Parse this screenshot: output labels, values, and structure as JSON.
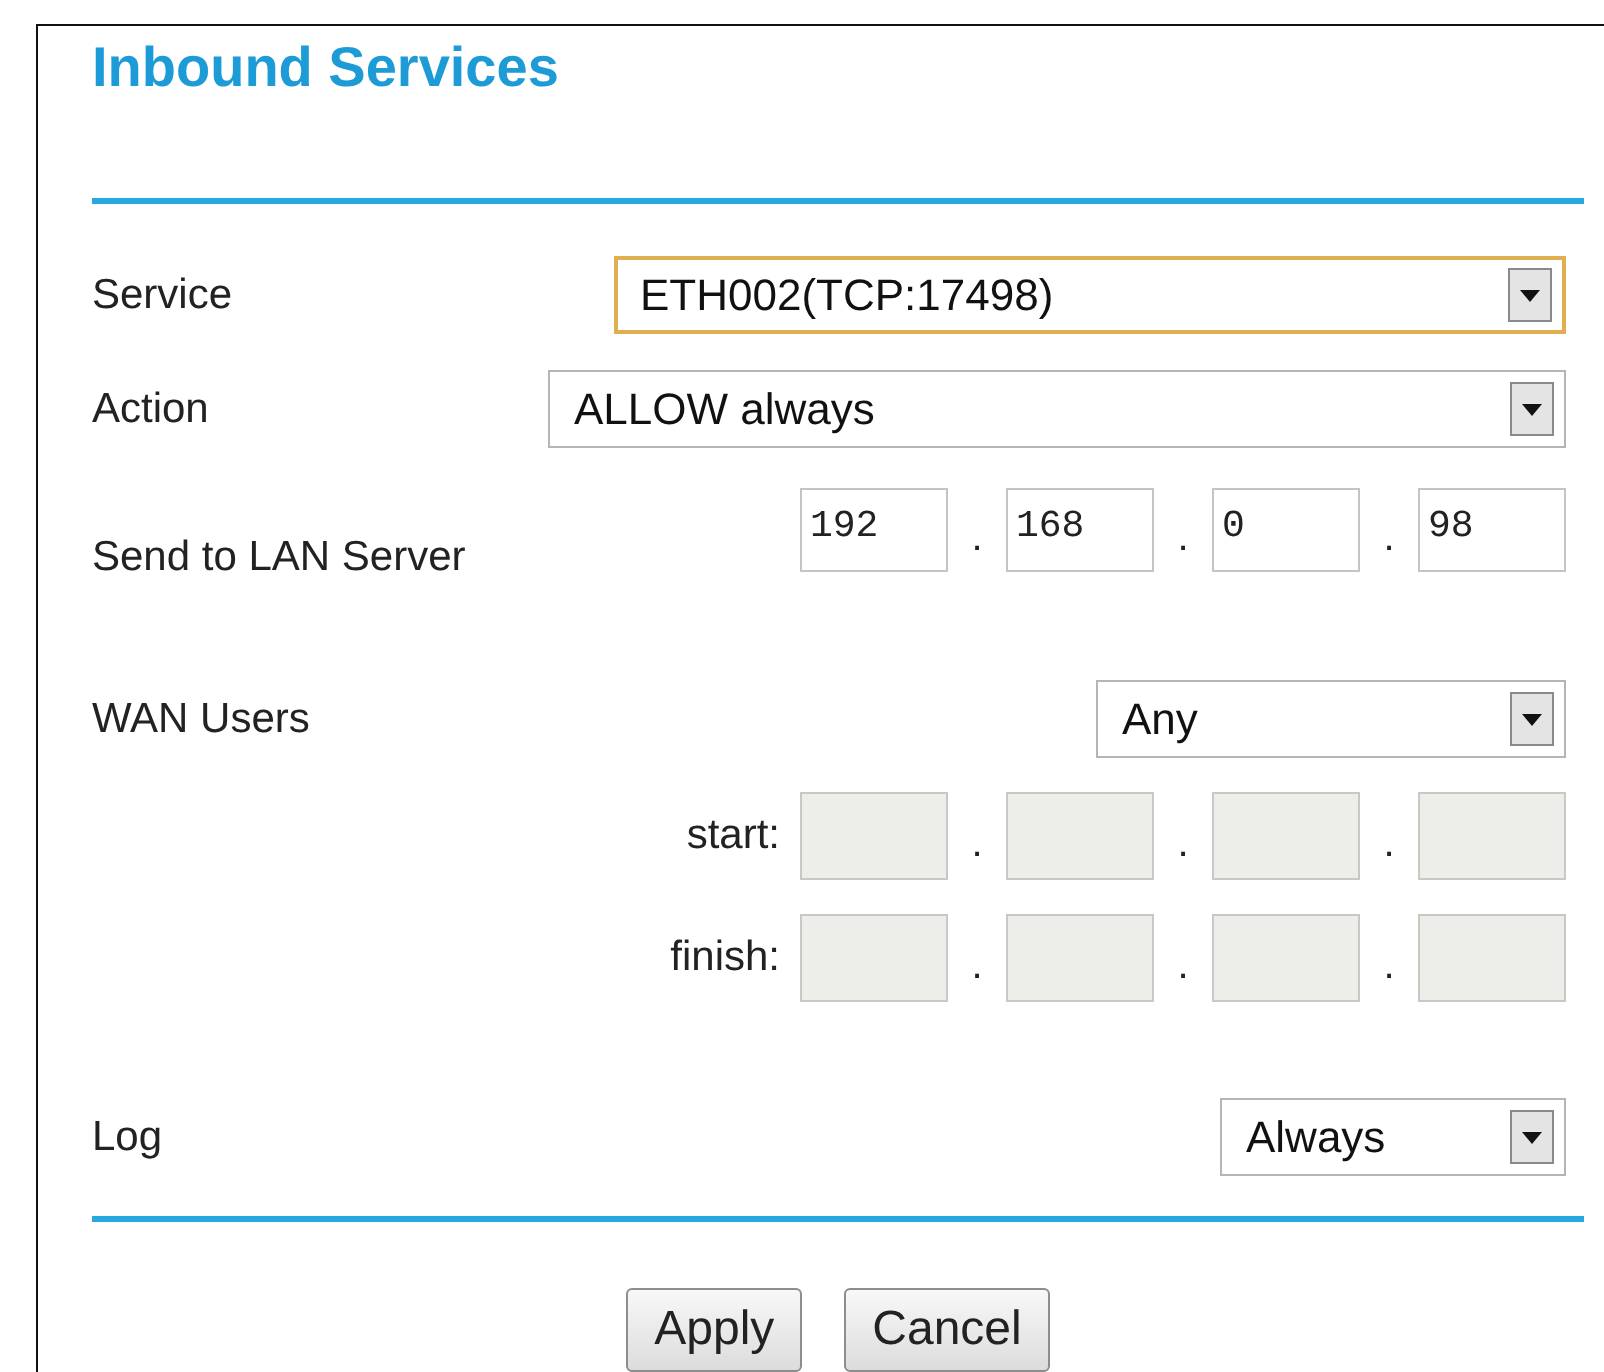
{
  "title": "Inbound Services",
  "fields": [
    {
      "kind": "select",
      "label": "Service",
      "value": "ETH002(TCP:17498)",
      "focused": true
    },
    {
      "kind": "select",
      "label": "Action",
      "value": "ALLOW always",
      "focused": false
    },
    {
      "kind": "ip",
      "label": "Send to LAN Server",
      "octets": [
        "192",
        "168",
        "0",
        "98"
      ],
      "separators": [
        ".",
        ".",
        "."
      ]
    },
    {
      "kind": "select",
      "label": "WAN Users",
      "value": "Any",
      "focused": false
    },
    {
      "kind": "range",
      "label": "start:",
      "disabled": true,
      "separators": [
        ".",
        ".",
        "."
      ]
    },
    {
      "kind": "range",
      "label": "finish:",
      "disabled": true,
      "separators": [
        ".",
        ".",
        "."
      ]
    },
    {
      "kind": "select",
      "label": "Log",
      "value": "Always",
      "focused": false
    }
  ],
  "buttons": [
    "Apply",
    "Cancel"
  ]
}
